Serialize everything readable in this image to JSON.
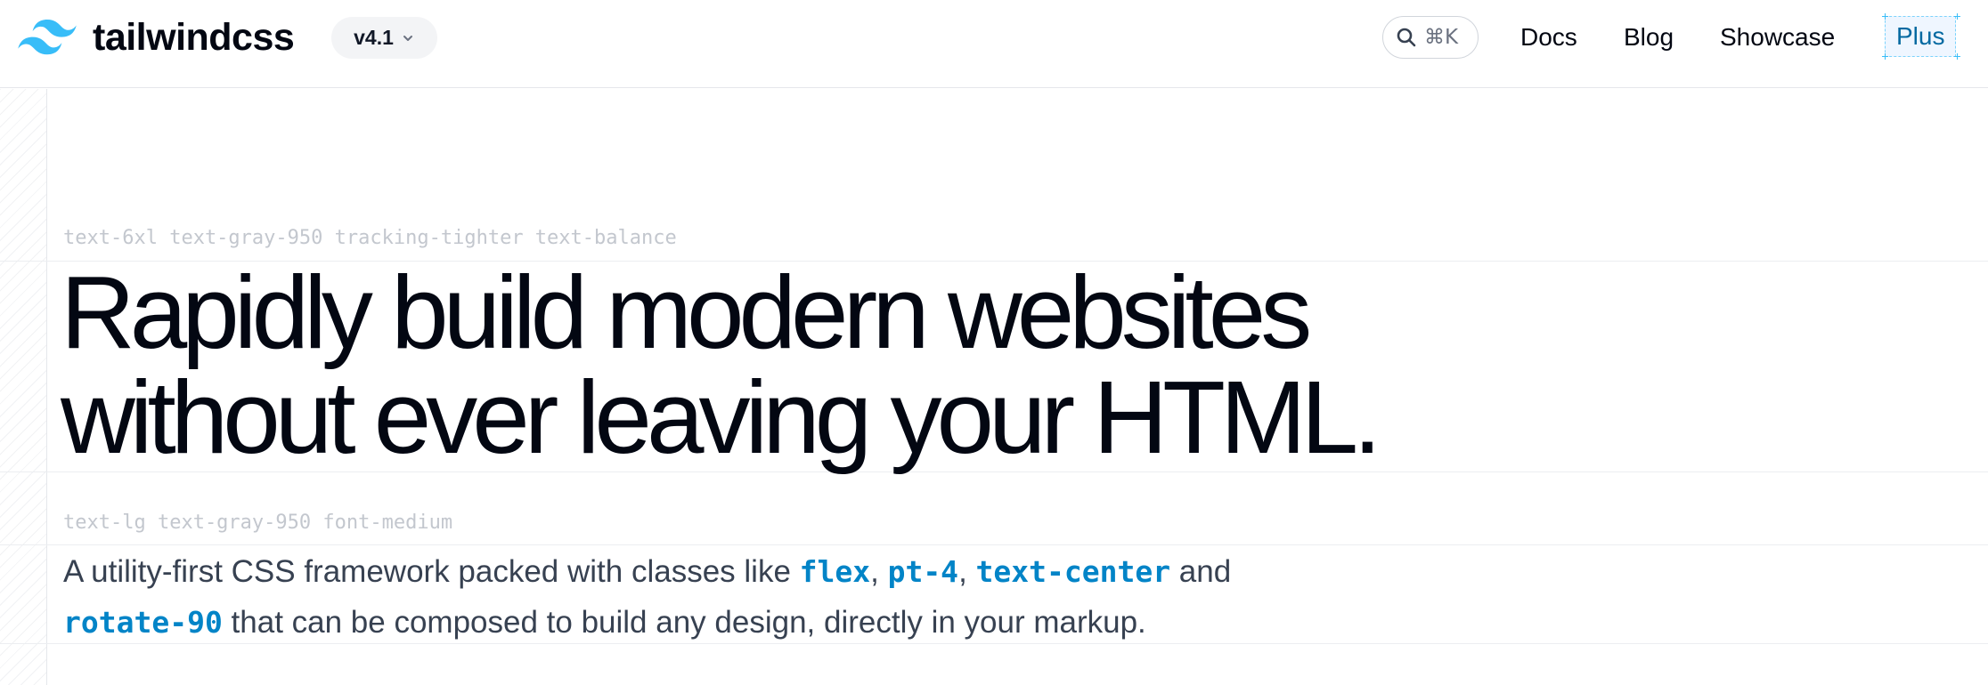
{
  "header": {
    "logo_text": "tailwindcss",
    "brand_color": "#38bdf8",
    "version": "v4.1",
    "search_shortcut": "⌘K",
    "nav": {
      "docs": "Docs",
      "blog": "Blog",
      "showcase": "Showcase",
      "plus": "Plus"
    }
  },
  "hero": {
    "headline_label": "text-6xl text-gray-950 tracking-tighter text-balance",
    "headline_line1": "Rapidly build modern websites",
    "headline_line2": "without ever leaving your HTML.",
    "subtitle_label": "text-lg text-gray-950 font-medium",
    "subtitle": {
      "part1": "A utility-first CSS framework packed with classes like ",
      "code1": "flex",
      "sep1": ", ",
      "code2": "pt-4",
      "sep2": ", ",
      "code3": "text-center",
      "part2": " and",
      "code4": "rotate-90",
      "part3": " that can be composed to build any design, directly in your markup."
    }
  }
}
